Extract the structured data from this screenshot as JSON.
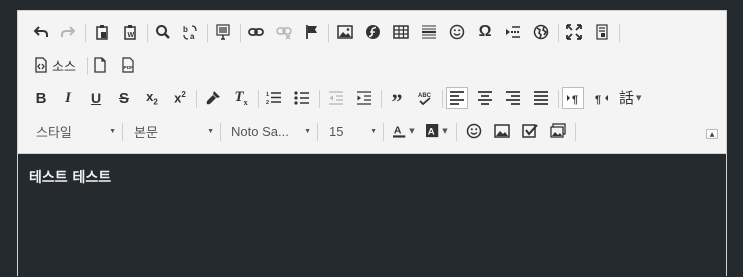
{
  "toolbar": {
    "source_label": "소스",
    "style_combo": "스타일",
    "format_combo": "본문",
    "font_combo": "Noto Sa...",
    "size_combo": "15",
    "language_glyph": "話"
  },
  "content": {
    "text": "테스트 테스트"
  },
  "colors": {
    "page_bg": "#252a2e",
    "toolbar_bg": "#f4f4f4",
    "border": "#d1d1d1",
    "icon": "#333333",
    "disabled_icon": "#b5b5b5",
    "content_text": "#f0f0f0"
  },
  "icons": [
    "undo-icon",
    "redo-icon",
    "paste-icon",
    "paste-from-word-icon",
    "find-icon",
    "replace-icon",
    "select-all-icon",
    "link-icon",
    "unlink-icon",
    "anchor-flag-icon",
    "image-icon",
    "flash-icon",
    "table-icon",
    "horizontal-rule-icon",
    "smiley-icon",
    "special-char-icon",
    "page-break-icon",
    "iframe-globe-icon",
    "maximize-icon",
    "show-blocks-icon",
    "source-icon",
    "new-page-icon",
    "export-pdf-icon",
    "bold-icon",
    "italic-icon",
    "underline-icon",
    "strike-icon",
    "subscript-icon",
    "superscript-icon",
    "copy-format-icon",
    "remove-format-icon",
    "numbered-list-icon",
    "bulleted-list-icon",
    "outdent-icon",
    "indent-icon",
    "blockquote-icon",
    "spellcheck-icon",
    "align-left-icon",
    "align-center-icon",
    "align-right-icon",
    "align-justify-icon",
    "ltr-icon",
    "rtl-icon",
    "language-icon",
    "text-color-icon",
    "bg-color-icon",
    "emoji-icon",
    "image-gallery-icon",
    "checkbox-icon",
    "image-stack-icon",
    "collapse-toolbar-icon"
  ]
}
